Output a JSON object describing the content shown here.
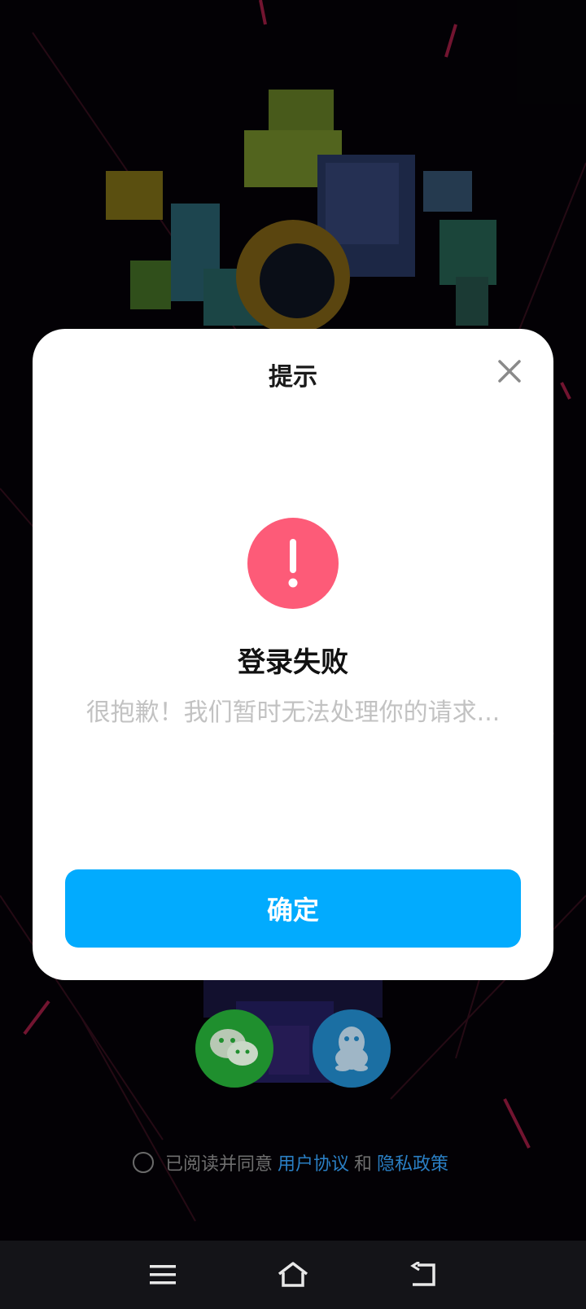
{
  "dialog": {
    "title": "提示",
    "close_icon": "close-icon",
    "alert_icon": "exclamation-icon",
    "heading": "登录失败",
    "message": "很抱歉！我们暂时无法处理你的请求...",
    "confirm_label": "确定"
  },
  "login_options": [
    {
      "name": "wechat",
      "icon": "wechat-icon",
      "color": "#1f8f2e"
    },
    {
      "name": "qq",
      "icon": "qq-icon",
      "color": "#1b6fa3"
    }
  ],
  "agreement": {
    "prefix": "已阅读并同意",
    "user_agreement": "用户协议",
    "conjunction": "和",
    "privacy_policy": "隐私政策"
  },
  "nav_bar": {
    "menu_icon": "menu-icon",
    "home_icon": "home-icon",
    "back_icon": "back-icon"
  },
  "colors": {
    "accent": "#02abfe",
    "alert": "#fd5b78",
    "link": "#2a7fc4"
  }
}
